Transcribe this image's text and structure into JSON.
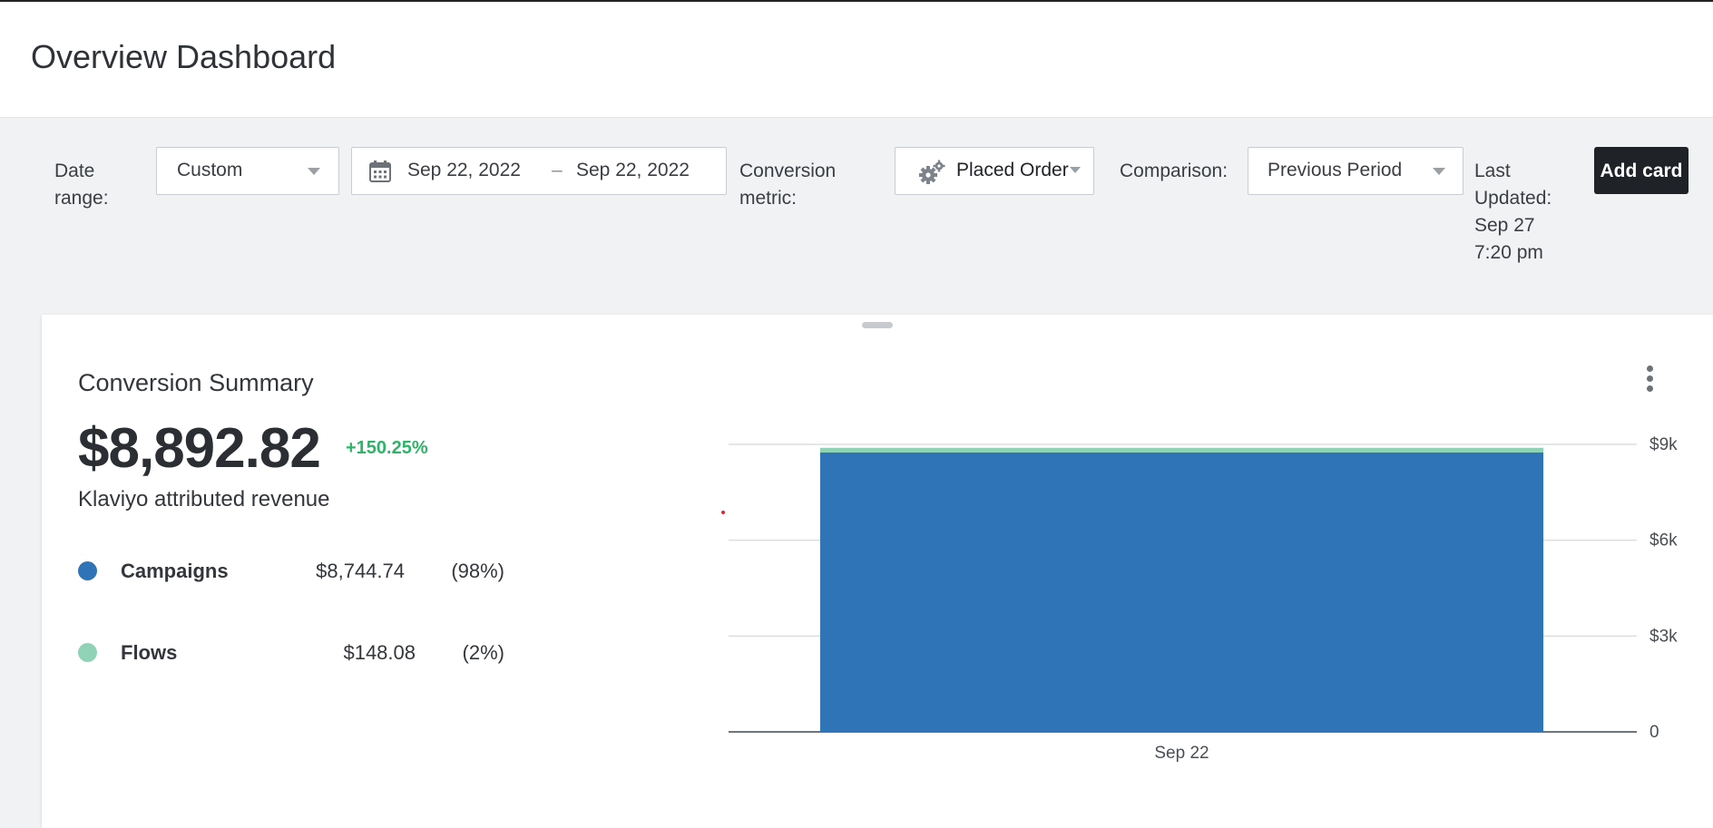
{
  "header": {
    "title": "Overview Dashboard"
  },
  "filters": {
    "date_range_label": [
      "Date",
      "range:"
    ],
    "date_range_value": "Custom",
    "start_date": "Sep 22, 2022",
    "date_separator": "–",
    "end_date": "Sep 22, 2022",
    "conversion_metric_label": [
      "Conversion",
      "metric:"
    ],
    "conversion_metric_value": "Placed Order",
    "comparison_label": "Comparison:",
    "comparison_value": "Previous Period",
    "last_updated": [
      "Last",
      "Updated:",
      "Sep 27",
      "7:20 pm"
    ],
    "add_card_label": "Add card"
  },
  "card": {
    "title": "Conversion Summary",
    "total": "$8,892.82",
    "change": "+150.25%",
    "subtitle": "Klaviyo attributed revenue",
    "menu_icon": "kebab-icon",
    "legend": [
      {
        "name": "Campaigns",
        "amount": "$8,744.74",
        "share": "(98%)",
        "color": "#3074b8"
      },
      {
        "name": "Flows",
        "amount": "$148.08",
        "share": "(2%)",
        "color": "#8fd3b6"
      }
    ]
  },
  "chart_data": {
    "type": "bar",
    "stacked": true,
    "categories": [
      "Sep 22"
    ],
    "series": [
      {
        "name": "Campaigns",
        "values": [
          8744.74
        ],
        "color": "#3074b8"
      },
      {
        "name": "Flows",
        "values": [
          148.08
        ],
        "color": "#8fd3b6"
      }
    ],
    "ylim": [
      0,
      9000
    ],
    "y_ticks": [
      {
        "value": 0,
        "label": "0"
      },
      {
        "value": 3000,
        "label": "$3k"
      },
      {
        "value": 6000,
        "label": "$6k"
      },
      {
        "value": 9000,
        "label": "$9k"
      }
    ],
    "y_axis_side": "right",
    "grid": true,
    "legend": "none"
  }
}
